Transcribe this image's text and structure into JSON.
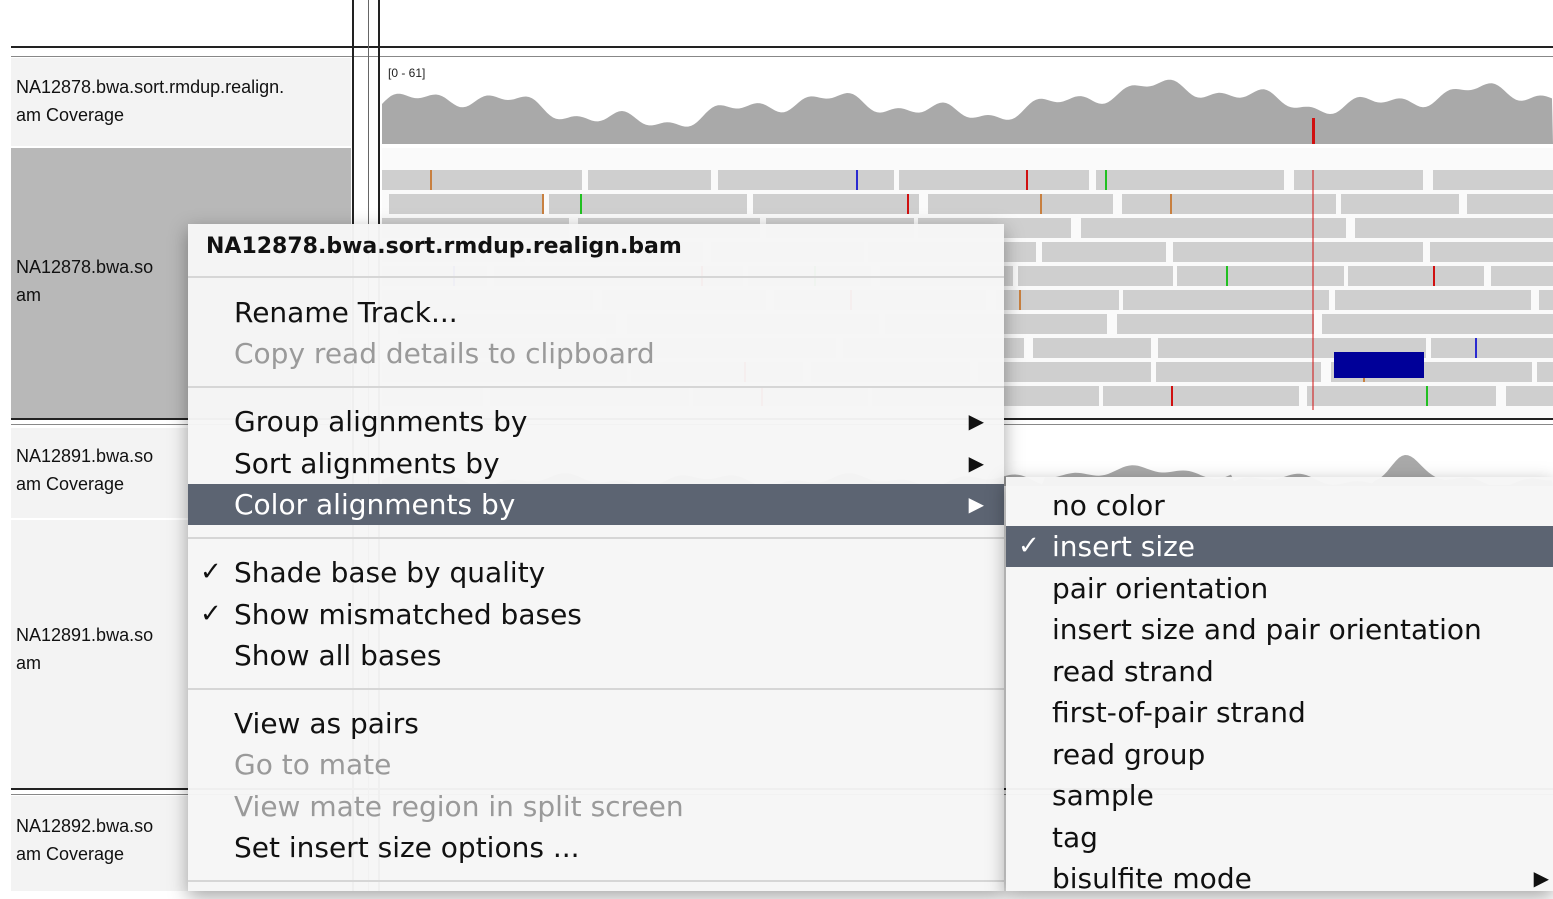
{
  "tracks": [
    {
      "name_line1": "NA12878.bwa.sort.rmdup.realign.",
      "name_line2": "am Coverage",
      "range": "[0 - 61]"
    },
    {
      "name_line1": "NA12878.bwa.so",
      "name_line2": "am"
    },
    {
      "name_line1": "NA12891.bwa.so",
      "name_line2": "am Coverage"
    },
    {
      "name_line1": "NA12891.bwa.so",
      "name_line2": "am"
    },
    {
      "name_line1": "NA12892.bwa.so",
      "name_line2": "am Coverage"
    }
  ],
  "context_menu": {
    "title": "NA12878.bwa.sort.rmdup.realign.bam",
    "groups": [
      [
        {
          "label": "Rename Track...",
          "enabled": true
        },
        {
          "label": "Copy read details to clipboard",
          "enabled": false
        }
      ],
      [
        {
          "label": "Group alignments by",
          "enabled": true,
          "submenu": true
        },
        {
          "label": "Sort alignments by",
          "enabled": true,
          "submenu": true
        },
        {
          "label": "Color alignments by",
          "enabled": true,
          "submenu": true,
          "highlighted": true
        }
      ],
      [
        {
          "label": "Shade base by quality",
          "enabled": true,
          "checked": true
        },
        {
          "label": "Show mismatched bases",
          "enabled": true,
          "checked": true
        },
        {
          "label": "Show all bases",
          "enabled": true
        }
      ],
      [
        {
          "label": "View as pairs",
          "enabled": true
        },
        {
          "label": "Go to mate",
          "enabled": false
        },
        {
          "label": "View mate region in split screen",
          "enabled": false
        },
        {
          "label": "Set insert size options ...",
          "enabled": true
        }
      ]
    ]
  },
  "color_submenu": {
    "items": [
      {
        "label": "no color"
      },
      {
        "label": "insert size",
        "checked": true,
        "highlighted": true
      },
      {
        "label": "pair orientation"
      },
      {
        "label": "insert size and pair orientation"
      },
      {
        "label": "read strand"
      },
      {
        "label": "first-of-pair strand"
      },
      {
        "label": "read group"
      },
      {
        "label": "sample"
      },
      {
        "label": "tag"
      },
      {
        "label": "bisulfite mode",
        "submenu": true
      }
    ]
  },
  "colors": {
    "highlight": "#5c6472",
    "read_fill": "#cfcfcf",
    "coverage_fill": "#a9a9a9",
    "mismatch_red": "#d01010",
    "mismatch_blue": "#2a2ad0",
    "mismatch_green": "#20c020",
    "mismatch_orange": "#c88040",
    "large_insert_read": "#000099"
  },
  "icons": {
    "check": "✓",
    "submenu_arrow": "▶"
  }
}
